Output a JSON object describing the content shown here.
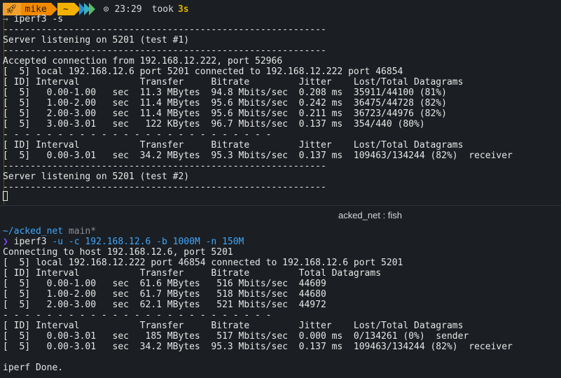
{
  "top_pane": {
    "prompt": {
      "user": "mike",
      "directory": "~",
      "time": "23:29",
      "took_label": "took",
      "took_value": "3s",
      "icon": "rocket-icon"
    },
    "command_prefix": "→",
    "command": "iperf3 -s",
    "lines": [
      "-----------------------------------------------------------",
      "Server listening on 5201 (test #1)",
      "-----------------------------------------------------------",
      "Accepted connection from 192.168.12.222, port 52966",
      "[  5] local 192.168.12.6 port 5201 connected to 192.168.12.222 port 46854",
      "[ ID] Interval           Transfer     Bitrate         Jitter    Lost/Total Datagrams",
      "[  5]   0.00-1.00   sec  11.3 MBytes  94.8 Mbits/sec  0.208 ms  35911/44100 (81%)",
      "[  5]   1.00-2.00   sec  11.4 MBytes  95.6 Mbits/sec  0.242 ms  36475/44728 (82%)",
      "[  5]   2.00-3.00   sec  11.4 MBytes  95.6 Mbits/sec  0.211 ms  36723/44976 (82%)",
      "[  5]   3.00-3.01   sec   122 KBytes  96.7 Mbits/sec  0.137 ms  354/440 (80%)",
      "- - - - - - - - - - - - - - - - - - - - - - - - -",
      "[ ID] Interval           Transfer     Bitrate         Jitter    Lost/Total Datagrams",
      "[  5]   0.00-3.01   sec  34.2 MBytes  95.3 Mbits/sec  0.137 ms  109463/134244 (82%)  receiver",
      "-----------------------------------------------------------",
      "Server listening on 5201 (test #2)",
      "-----------------------------------------------------------"
    ]
  },
  "tab_title": "acked_net : fish",
  "bottom_pane": {
    "cwd": "~/acked_net",
    "branch": "main*",
    "prompt_char": "❯",
    "command_name": "iperf3",
    "command_args": "-u -c 192.168.12.6 -b 1000M -n 150M",
    "lines": [
      "Connecting to host 192.168.12.6, port 5201",
      "[  5] local 192.168.12.222 port 46854 connected to 192.168.12.6 port 5201",
      "[ ID] Interval           Transfer     Bitrate         Total Datagrams",
      "[  5]   0.00-1.00   sec  61.6 MBytes   516 Mbits/sec  44609",
      "[  5]   1.00-2.00   sec  61.7 MBytes   518 Mbits/sec  44680",
      "[  5]   2.00-3.00   sec  62.1 MBytes   521 Mbits/sec  44972",
      "- - - - - - - - - - - - - - - - - - - - - - - - -",
      "[ ID] Interval           Transfer     Bitrate         Jitter    Lost/Total Datagrams",
      "[  5]   0.00-3.01   sec   185 MBytes   517 Mbits/sec  0.000 ms  0/134261 (0%)  sender",
      "[  5]   0.00-3.01   sec  34.2 MBytes  95.3 Mbits/sec  0.137 ms  109463/134244 (82%)  receiver",
      "",
      "iperf Done."
    ]
  },
  "colors": {
    "background": "#1b1e22",
    "prompt_orange": "#f28a00",
    "path_blue": "#3fa7ff",
    "took_yellow": "#e0b400"
  }
}
